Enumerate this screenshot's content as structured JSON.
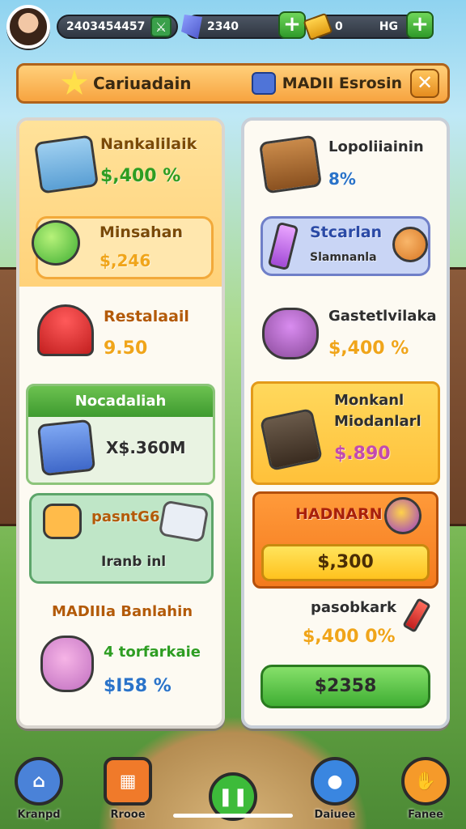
{
  "topbar": {
    "player_id": "2403454457",
    "gems": "2340",
    "gold": "0",
    "gold_extra": "HG"
  },
  "titlebar": {
    "left_title": "Cariuadain",
    "right_title": "MADII Esrosin",
    "close_label": "✕"
  },
  "left_panel": {
    "item1": {
      "title": "Nankalilaik",
      "value": "$,400 %"
    },
    "item2": {
      "title": "Minsahan",
      "value": "$,246"
    },
    "item3": {
      "title": "Restalaail",
      "value": "9.50"
    },
    "item4": {
      "title": "Nocadaliah",
      "value": "X$.360M"
    },
    "item5": {
      "title": "pasntG6",
      "subtitle": "Iranb inl"
    },
    "item6": {
      "title": "MADIIIa Banlahin",
      "subtitle": "4 torfarkaie",
      "value": "$I58 %"
    }
  },
  "right_panel": {
    "item1": {
      "title": "Lopoliiainin",
      "value": "8%"
    },
    "item2": {
      "title": "Stcarlan",
      "subtitle": "Slamnanla"
    },
    "item3": {
      "title": "Gastetlvilaka",
      "value": "$,400 %"
    },
    "item4": {
      "title": "Monkanl",
      "subtitle": "Miodanlarl",
      "value": "$.890"
    },
    "item5": {
      "title": "HADNARN",
      "button": "$,300"
    },
    "item6": {
      "title": "pasobkark",
      "value": "$,400 0%",
      "button": "$2358"
    }
  },
  "bottomnav": {
    "items": [
      {
        "label": "Kranpd",
        "color": "#4a82d8"
      },
      {
        "label": "Rrooe",
        "color": "#f07a2a"
      },
      {
        "label": "",
        "color": "#3dbb3a"
      },
      {
        "label": "Daiuee",
        "color": "#3a86e0"
      },
      {
        "label": "Fanee",
        "color": "#f59a2a"
      }
    ]
  },
  "colors": {
    "accent_orange": "#f7a440",
    "accent_green": "#3fae33",
    "value_green": "#2e9d22",
    "value_yellow": "#f0a51a",
    "value_blue": "#2a73c9"
  }
}
